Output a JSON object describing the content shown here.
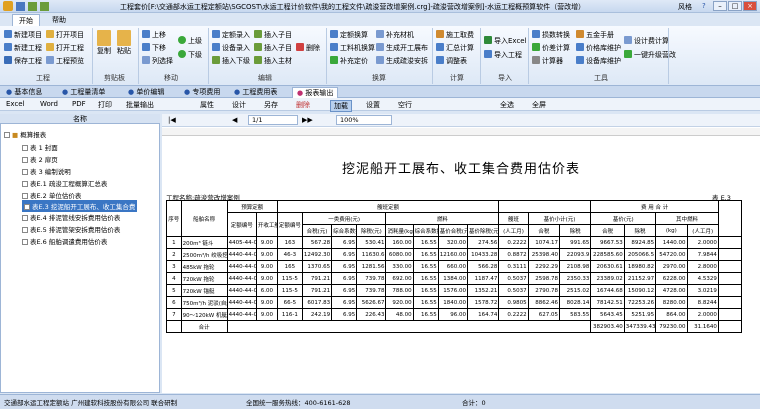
{
  "app": {
    "title": "工程套价[F:\\交通部水运工程定额站\\SGCOST\\水运工程计价软件\\我的工程文件\\疏浚营改增案例.crg]-疏浚营改增案例]-水运工程概预算软件（营改增）",
    "style": "风格",
    "help": "?"
  },
  "menubar": {
    "tabs": [
      "开始",
      "帮助"
    ]
  },
  "ribbon": {
    "items": [
      {
        "id": "new-project",
        "label": "新建项目"
      },
      {
        "id": "open-project",
        "label": "打开项目"
      },
      {
        "id": "new-work",
        "label": "新建工程"
      },
      {
        "id": "open-work",
        "label": "打开工程"
      },
      {
        "id": "save-work",
        "label": "保存工程"
      },
      {
        "id": "work-bak",
        "label": "工程预览"
      },
      {
        "id": "copy",
        "label": "复制"
      },
      {
        "id": "paste",
        "label": "粘贴"
      },
      {
        "id": "up",
        "label": "上移"
      },
      {
        "id": "down",
        "label": "下移"
      },
      {
        "id": "col-select",
        "label": "列选择"
      },
      {
        "id": "up-level",
        "label": "上级"
      },
      {
        "id": "down-level",
        "label": "下级"
      },
      {
        "id": "quota-import",
        "label": "定额录入"
      },
      {
        "id": "insert-sub",
        "label": "插入子目"
      },
      {
        "id": "device-import",
        "label": "设备录入"
      },
      {
        "id": "insert-lib",
        "label": "插入子目"
      },
      {
        "id": "insert-sub2",
        "label": "插入下级"
      },
      {
        "id": "insert-main",
        "label": "插入主材"
      },
      {
        "id": "delete",
        "label": "删除"
      },
      {
        "id": "quota-convert",
        "label": "定额换算"
      },
      {
        "id": "work-material",
        "label": "工料机换算"
      },
      {
        "id": "fill-price",
        "label": "补充定价"
      },
      {
        "id": "supp-material",
        "label": "补充材机"
      },
      {
        "id": "gen-project",
        "label": "生成开工展布"
      },
      {
        "id": "gen-dredge",
        "label": "生成疏浚安拆"
      },
      {
        "id": "construct-fee",
        "label": "施工取费"
      },
      {
        "id": "summary",
        "label": "汇总计算"
      },
      {
        "id": "adjust-table",
        "label": "调整表"
      },
      {
        "id": "import-excel",
        "label": "导入Excel"
      },
      {
        "id": "import-project",
        "label": "导入工程"
      },
      {
        "id": "rate-convert",
        "label": "损数转换"
      },
      {
        "id": "price-calc",
        "label": "价差计算"
      },
      {
        "id": "calculator",
        "label": "计算器"
      },
      {
        "id": "hardware",
        "label": "五金手册"
      },
      {
        "id": "price-maintain",
        "label": "价格库维护"
      },
      {
        "id": "device-maintain",
        "label": "设备库维护"
      },
      {
        "id": "design-calc",
        "label": "设计费计算"
      },
      {
        "id": "upgrade",
        "label": "一键升级营改"
      }
    ],
    "groups": [
      "工程",
      "剪贴板",
      "移动",
      "编辑",
      "换算",
      "计算",
      "导入",
      "工具"
    ]
  },
  "doc_tabs": [
    "基本信息",
    "工程量清单",
    "单价编辑",
    "专项费用",
    "工程费用表",
    "报表输出"
  ],
  "toolbar2": [
    "Excel",
    "Word",
    "PDF",
    "打印",
    "批量输出",
    "属性",
    "设计",
    "另存",
    "删除",
    "加载",
    "设置",
    "空行",
    "全选",
    "全屏"
  ],
  "sidebar": {
    "header": "名称",
    "items": [
      "概算报表",
      "表 1 封面",
      "表 2 扉页",
      "表 3 编制说明",
      "表E.1 疏浚工程概算汇总表",
      "表E.2 单位估价表",
      "表E.3 挖泥船开工展布、收工集合费",
      "表E.4 排泥管线安拆费用估价表",
      "表E.5 排泥管架安拆费用估价表",
      "表E.6 船舶调遣费用估价表"
    ]
  },
  "viewer": {
    "page": "1/1",
    "zoom": "100%"
  },
  "report": {
    "title": "挖泥船开工展布、收工集合费用估价表",
    "project": "工程名称:疏浚营改增案例",
    "table_no": "表 E.3",
    "headers": {
      "no": "序号",
      "ship": "船舶名称",
      "quota": "预算定额",
      "quota_no": "定额编号",
      "days": "开收工艘班",
      "quota2": "定额编号",
      "basic": "艘班定额",
      "class1": "一类费用(元)",
      "fuel": "燃料",
      "ship_team": "艘班",
      "price": "基价小计(元)",
      "cost": "费 用 合 计",
      "base": "基价(元)",
      "fuel2": "其中燃料",
      "c_tax": "合税(元)",
      "c_comp": "综合系数扣率(%)",
      "c_notax": "除税(元)",
      "f_qty": "消耗量(kg)",
      "f_rate": "综合系数扣率(%)",
      "f_price_tax": "基价合税(元)",
      "f_price_notax": "基价除税(元)",
      "s_unit": "(人工月)",
      "p_tax": "合税",
      "p_notax": "除税",
      "t_tax": "合税",
      "t_notax": "除税",
      "t_kg": "(kg)",
      "t_unit": "(人工月)",
      "remark": "备注"
    },
    "rows": [
      [
        "1",
        "200m³ 链斗",
        "4405-44-05",
        "9.00",
        "163",
        "567.28",
        "6.95",
        "530.41",
        "160.00",
        "16.55",
        "320.00",
        "274.56",
        "0.2222",
        "1074.17",
        "991.65",
        "9667.53",
        "8924.85",
        "1440.00",
        "2.0000"
      ],
      [
        "2",
        "2500m³/h 绞吸挖泥船",
        "4440-44-04",
        "9.00",
        "46-3",
        "12492.30",
        "6.95",
        "11630.6",
        "6080.00",
        "16.55",
        "12160.00",
        "10433.28",
        "0.8872",
        "25398.40",
        "22093.9",
        "228585.60",
        "205066.5",
        "54720.00",
        "7.9844"
      ],
      [
        "3",
        "485kW 拖轮",
        "4440-44-04",
        "9.00",
        "165",
        "1370.65",
        "6.95",
        "1281.56",
        "330.00",
        "16.55",
        "660.00",
        "566.28",
        "0.3111",
        "2292.29",
        "2108.98",
        "20630.61",
        "18980.82",
        "2970.00",
        "2.8000"
      ],
      [
        "4",
        "720kW 拖轮",
        "4440-44-04",
        "9.00",
        "115-5",
        "791.21",
        "6.95",
        "739.78",
        "692.00",
        "16.55",
        "1384.00",
        "1187.47",
        "0.5037",
        "2598.78",
        "2350.33",
        "23389.02",
        "21152.97",
        "6228.00",
        "4.5329"
      ],
      [
        "5",
        "720kW 锚艇",
        "4440-44-04",
        "6.00",
        "115-5",
        "791.21",
        "6.95",
        "739.78",
        "788.00",
        "16.55",
        "1576.00",
        "1352.21",
        "0.5037",
        "2790.78",
        "2515.02",
        "16744.68",
        "15090.12",
        "4728.00",
        "3.0219"
      ],
      [
        "6",
        "750m³/h 泥驳(自航)",
        "4440-44-05",
        "9.00",
        "66-5",
        "6017.83",
        "6.95",
        "5626.67",
        "920.00",
        "16.55",
        "1840.00",
        "1578.72",
        "0.9805",
        "8862.46",
        "8028.14",
        "78142.51",
        "72253.26",
        "8280.00",
        "8.8244"
      ],
      [
        "7",
        "90～120kW 机艇",
        "4440-44-04",
        "9.00",
        "116-1",
        "242.19",
        "6.95",
        "226.43",
        "48.00",
        "16.55",
        "96.00",
        "164.74",
        "0.2222",
        "627.05",
        "583.55",
        "5643.45",
        "5251.95",
        "864.00",
        "2.0000"
      ]
    ],
    "total": {
      "label": "合计",
      "a": "382903.40",
      "b": "347339.43",
      "c": "79230.00",
      "d": "31.1640"
    }
  },
  "status": {
    "left": "交通部水运工程定额站  广州建软科技股份有限公司  联合研制",
    "mid": "全国统一服务热线：400-6161-628",
    "right": "合计：0"
  }
}
